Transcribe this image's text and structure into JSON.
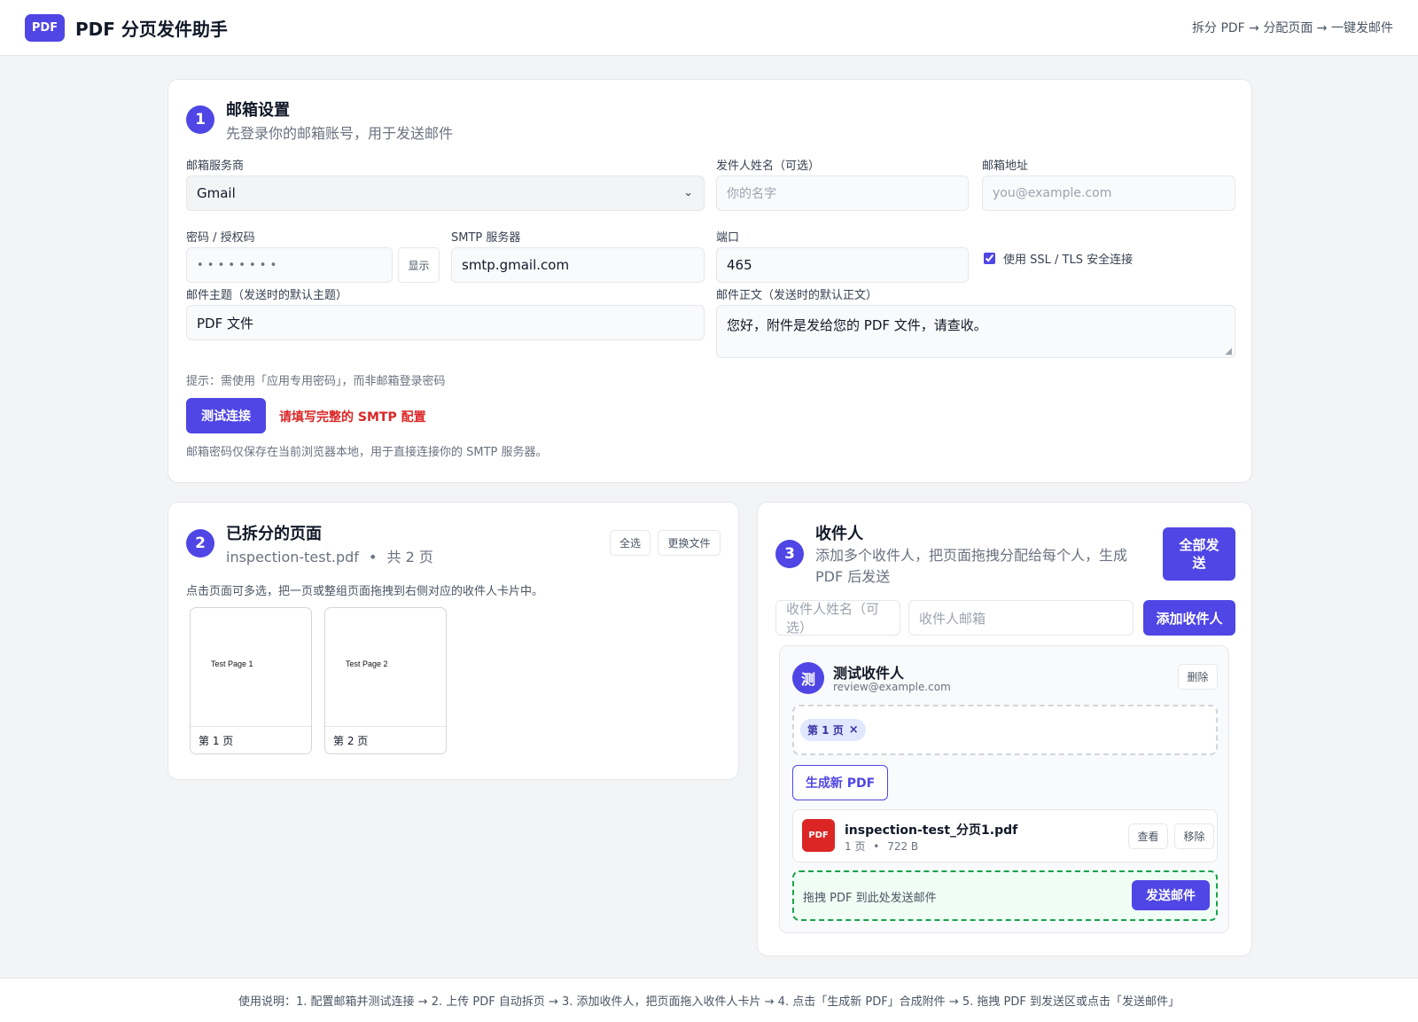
{
  "header": {
    "logo": "PDF",
    "title": "PDF 分页发件助手",
    "flow": "拆分 PDF → 分配页面 → 一键发邮件"
  },
  "email_settings": {
    "step": "1",
    "title": "邮箱设置",
    "subtitle": "先登录你的邮箱账号，用于发送邮件",
    "provider_label": "邮箱服务商",
    "provider_value": "Gmail",
    "sender_name_label": "发件人姓名（可选）",
    "sender_name_placeholder": "你的名字",
    "email_label": "邮箱地址",
    "email_placeholder": "you@example.com",
    "password_label": "密码 / 授权码",
    "password_mask": "• • • • • • • •",
    "show_button": "显示",
    "smtp_label": "SMTP 服务器",
    "smtp_value": "smtp.gmail.com",
    "port_label": "端口",
    "port_value": "465",
    "ssl_checked": true,
    "ssl_label": "使用 SSL / TLS 安全连接",
    "subject_label": "邮件主题（发送时的默认主题）",
    "subject_value": "PDF 文件",
    "body_label": "邮件正文（发送时的默认正文）",
    "body_value": "您好，附件是发给您的 PDF 文件，请查收。",
    "tip": "提示：需使用「应用专用密码」，而非邮箱登录密码",
    "test_button": "测试连接",
    "error_message": "请填写完整的 SMTP 配置",
    "privacy_note": "邮箱密码仅保存在当前浏览器本地，用于直接连接你的 SMTP 服务器。"
  },
  "pages": {
    "step": "2",
    "title": "已拆分的页面",
    "file_name": "inspection-test.pdf",
    "separator": "•",
    "page_count": "共 2 页",
    "select_all": "全选",
    "replace_file": "更换文件",
    "instruction": "点击页面可多选，把一页或整组页面拖拽到右侧对应的收件人卡片中。",
    "items": [
      {
        "content": "Test Page 1",
        "label": "第 1 页"
      },
      {
        "content": "Test Page 2",
        "label": "第 2 页"
      }
    ]
  },
  "recipients": {
    "step": "3",
    "title": "收件人",
    "subtitle_line1": "添加多个收件人，把页面拖拽分配给每个人，生成",
    "subtitle_line2": "PDF 后发送",
    "send_all_line1": "全部发",
    "send_all_line2": "送",
    "name_placeholder": "收件人姓名（可选）",
    "email_placeholder": "收件人邮箱",
    "add_button": "添加收件人",
    "list": [
      {
        "avatar": "测",
        "name": "测试收件人",
        "email": "review@example.com",
        "delete": "删除",
        "chips": [
          {
            "label": "第 1 页",
            "remove": "×"
          }
        ],
        "generate": "生成新 PDF",
        "file": {
          "icon": "PDF",
          "name": "inspection-test_分页1.pdf",
          "pages": "1 页",
          "separator": "•",
          "size": "722 B",
          "view": "查看",
          "remove": "移除"
        },
        "send_zone_text": "拖拽 PDF 到此处发送邮件",
        "send_button": "发送邮件"
      }
    ]
  },
  "footer": {
    "text": "使用说明：1. 配置邮箱并测试连接 → 2. 上传 PDF 自动拆页 → 3. 添加收件人，把页面拖入收件人卡片 → 4. 点击「生成新 PDF」合成附件 → 5. 拖拽 PDF 到发送区或点击「发送邮件」"
  },
  "colors": {
    "accent": "#4f46e5",
    "error": "#dc2626",
    "success": "#16a34a",
    "chip_bg": "#e0e7ff"
  }
}
